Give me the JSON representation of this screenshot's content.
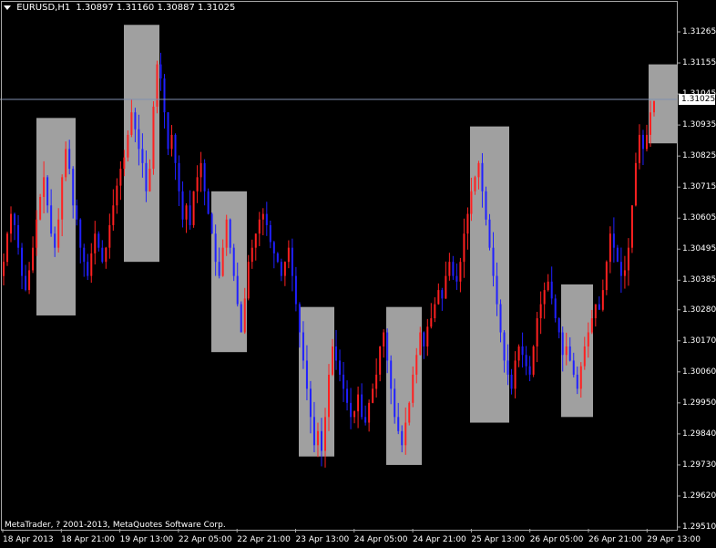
{
  "header": {
    "symbol": "EURUSD,H1",
    "ohlc": "1.30897 1.31160 1.30887 1.31025"
  },
  "copyright": "MetaTrader, ? 2001-2013, MetaQuotes Software Corp.",
  "current_price": "1.31025",
  "price_axis": [
    "1.31265",
    "1.31155",
    "1.31045",
    "1.30935",
    "1.30825",
    "1.30715",
    "1.30605",
    "1.30495",
    "1.30385",
    "1.30280",
    "1.30170",
    "1.30060",
    "1.29950",
    "1.29840",
    "1.29730",
    "1.29620",
    "1.29510"
  ],
  "time_axis": [
    "18 Apr 2013",
    "18 Apr 21:00",
    "19 Apr 13:00",
    "22 Apr 05:00",
    "22 Apr 21:00",
    "23 Apr 13:00",
    "24 Apr 05:00",
    "24 Apr 21:00",
    "25 Apr 13:00",
    "26 Apr 05:00",
    "26 Apr 21:00",
    "29 Apr 13:00"
  ],
  "colors": {
    "bull": "#ff2020",
    "bear": "#2020ff",
    "box": "#a0a0a0",
    "grid": "#a8a8a8",
    "background": "#000000",
    "hline": "#8090b0"
  },
  "chart_data": {
    "type": "candlestick",
    "title": "EURUSD,H1",
    "ylim": [
      1.2951,
      1.3137
    ],
    "current_price": 1.31025,
    "shaded_zones": [
      {
        "start": "18 Apr 2013 10:00",
        "end": "18 Apr 19:00",
        "high": 1.3096,
        "low": 1.3026
      },
      {
        "start": "19 Apr 11:00",
        "end": "19 Apr 20:00",
        "high": 1.3129,
        "low": 1.3045
      },
      {
        "start": "22 Apr 11:00",
        "end": "22 Apr 20:00",
        "high": 1.307,
        "low": 1.3013
      },
      {
        "start": "23 Apr 11:00",
        "end": "23 Apr 20:00",
        "high": 1.3029,
        "low": 1.2976
      },
      {
        "start": "24 Apr 11:00",
        "end": "24 Apr 20:00",
        "high": 1.3029,
        "low": 1.2973
      },
      {
        "start": "25 Apr 11:00",
        "end": "25 Apr 20:00",
        "high": 1.3093,
        "low": 1.2988
      },
      {
        "start": "26 Apr 11:00",
        "end": "26 Apr 20:00",
        "high": 1.3037,
        "low": 1.299
      },
      {
        "start": "29 Apr 11:00",
        "end": "29 Apr 18:00",
        "high": 1.3115,
        "low": 1.3087
      }
    ],
    "closes": [
      1.3045,
      1.3055,
      1.3062,
      1.3058,
      1.305,
      1.304,
      1.3035,
      1.3042,
      1.305,
      1.306,
      1.3068,
      1.3075,
      1.3065,
      1.3055,
      1.305,
      1.306,
      1.3075,
      1.3085,
      1.3078,
      1.3065,
      1.306,
      1.305,
      1.3045,
      1.304,
      1.3048,
      1.3055,
      1.305,
      1.3045,
      1.305,
      1.3058,
      1.3065,
      1.3072,
      1.3078,
      1.3082,
      1.309,
      1.3098,
      1.3092,
      1.3085,
      1.308,
      1.307,
      1.3078,
      1.31,
      1.3115,
      1.311,
      1.3098,
      1.3085,
      1.309,
      1.308,
      1.307,
      1.306,
      1.3065,
      1.3058,
      1.307,
      1.3075,
      1.308,
      1.307,
      1.3062,
      1.3055,
      1.3045,
      1.304,
      1.305,
      1.306,
      1.305,
      1.304,
      1.303,
      1.302,
      1.3032,
      1.3045,
      1.305,
      1.3055,
      1.306,
      1.3062,
      1.3058,
      1.3052,
      1.3048,
      1.3045,
      1.304,
      1.3045,
      1.305,
      1.304,
      1.303,
      1.302,
      1.301,
      1.3,
      1.299,
      1.298,
      1.2985,
      1.2978,
      1.299,
      1.3005,
      1.3015,
      1.301,
      1.3005,
      1.3,
      1.2995,
      1.299,
      1.2992,
      1.2998,
      1.299,
      1.2988,
      1.2995,
      1.3,
      1.3005,
      1.3015,
      1.302,
      1.301,
      1.3,
      1.299,
      1.2985,
      1.298,
      1.2988,
      1.2995,
      1.3005,
      1.3012,
      1.302,
      1.3015,
      1.3022,
      1.3025,
      1.303,
      1.3035,
      1.3032,
      1.304,
      1.3045,
      1.304,
      1.3038,
      1.3045,
      1.3055,
      1.3062,
      1.307,
      1.3075,
      1.308,
      1.307,
      1.306,
      1.305,
      1.304,
      1.303,
      1.302,
      1.301,
      1.3005,
      1.3,
      1.301,
      1.3015,
      1.3012,
      1.3008,
      1.3005,
      1.3015,
      1.3025,
      1.303,
      1.3035,
      1.3038,
      1.3032,
      1.3025,
      1.302,
      1.3012,
      1.3015,
      1.301,
      1.3005,
      1.3,
      1.3008,
      1.3015,
      1.302,
      1.3025,
      1.303,
      1.3028,
      1.3035,
      1.3045,
      1.3055,
      1.305,
      1.3045,
      1.304,
      1.3042,
      1.305,
      1.3065,
      1.308,
      1.309,
      1.3085,
      1.309,
      1.3098,
      1.3102
    ]
  }
}
